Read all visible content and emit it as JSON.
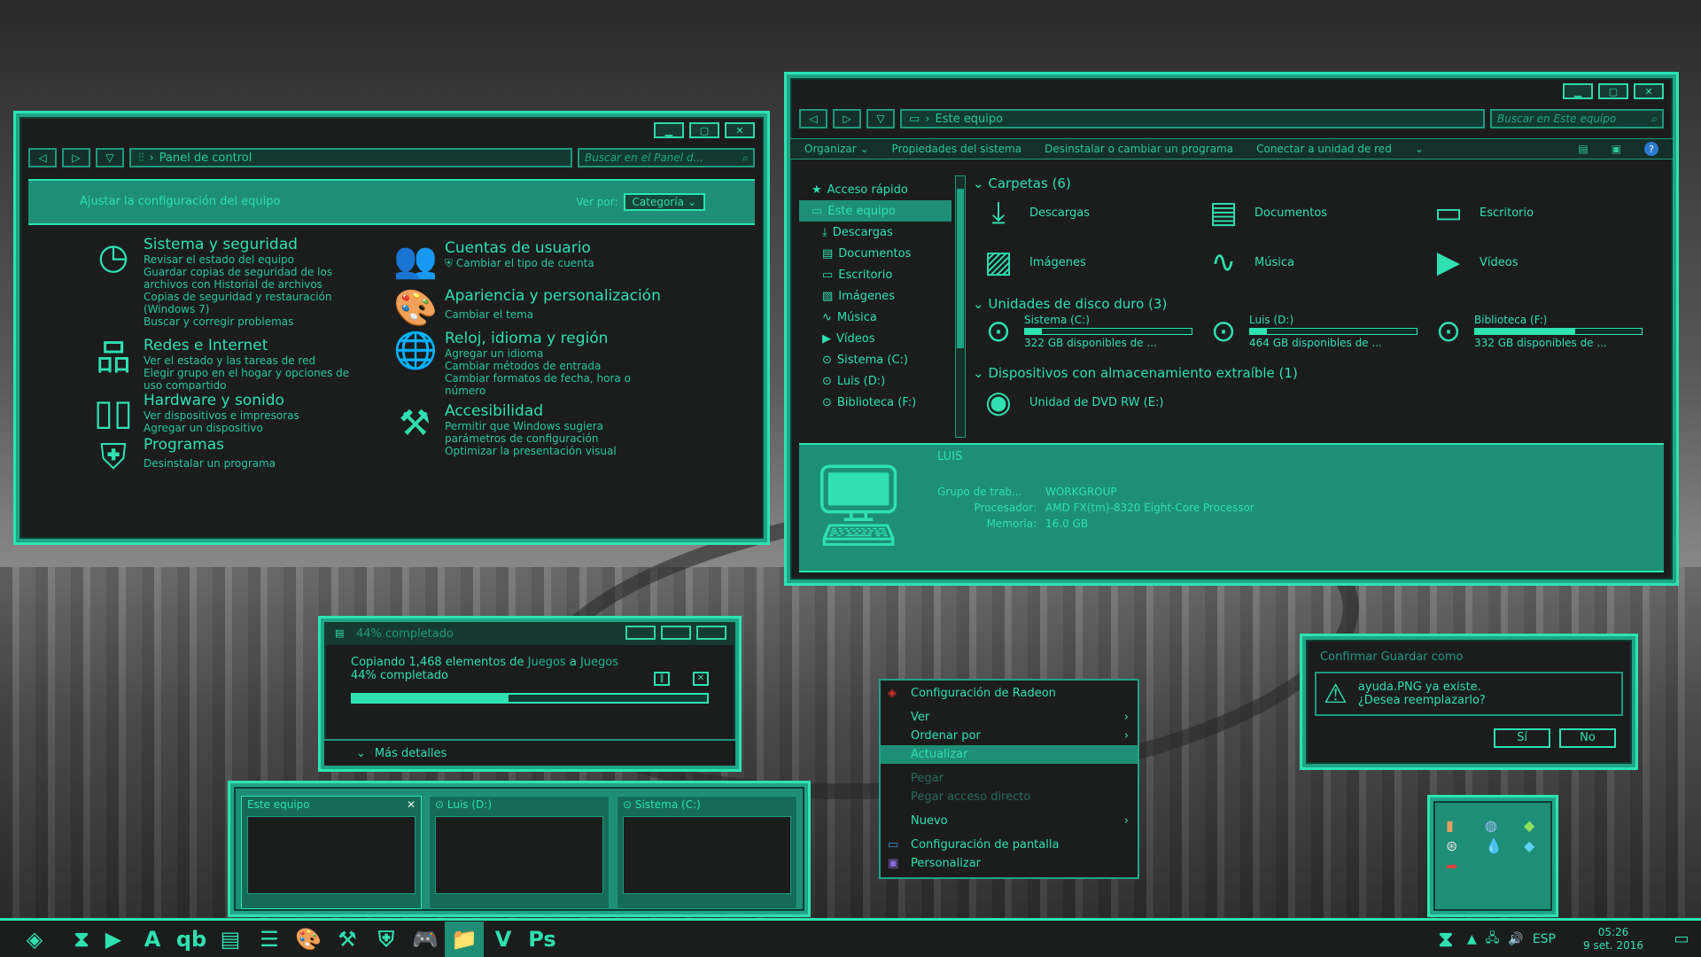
{
  "control_panel": {
    "address": "Panel de control",
    "search_placeholder": "Buscar en el Panel d...",
    "header_title": "Ajustar la configuración del equipo",
    "view_by_label": "Ver por:",
    "view_by_value": "Categoría",
    "categories": [
      {
        "title": "Sistema y seguridad",
        "links": [
          "Revisar el estado del equipo",
          "Guardar copias de seguridad de los",
          "archivos con Historial de archivos",
          "Copias de seguridad y restauración",
          "(Windows 7)",
          "Buscar y corregir problemas"
        ]
      },
      {
        "title": "Redes e Internet",
        "links": [
          "Ver el estado y las tareas de red",
          "Elegir grupo en el hogar y opciones de",
          "uso compartido"
        ]
      },
      {
        "title": "Hardware y sonido",
        "links": [
          "Ver dispositivos e impresoras",
          "Agregar un dispositivo"
        ]
      },
      {
        "title": "Programas",
        "links": [
          "Desinstalar un programa"
        ]
      },
      {
        "title": "Cuentas de usuario",
        "links": [
          "Cambiar el tipo de cuenta"
        ]
      },
      {
        "title": "Apariencia y personalización",
        "links": [
          "Cambiar el tema"
        ]
      },
      {
        "title": "Reloj, idioma y región",
        "links": [
          "Agregar un idioma",
          "Cambiar métodos de entrada",
          "Cambiar formatos de fecha, hora o",
          "número"
        ]
      },
      {
        "title": "Accesibilidad",
        "links": [
          "Permitir que Windows sugiera",
          "parámetros de configuración",
          "Optimizar la presentación visual"
        ]
      }
    ]
  },
  "explorer": {
    "address": "Este equipo",
    "search_placeholder": "Buscar en Este equipo",
    "toolbar": [
      "Organizar",
      "Propiedades del sistema",
      "Desinstalar o cambiar un programa",
      "Conectar a unidad de red"
    ],
    "sidebar": [
      "Acceso rápido",
      "Este equipo",
      "Descargas",
      "Documentos",
      "Escritorio",
      "Imágenes",
      "Música",
      "Vídeos",
      "Sistema (C:)",
      "Luis (D:)",
      "Biblioteca (F:)"
    ],
    "folders_title": "Carpetas (6)",
    "folders": [
      "Descargas",
      "Documentos",
      "Escritorio",
      "Imágenes",
      "Música",
      "Vídeos"
    ],
    "drives_title": "Unidades de disco duro (3)",
    "drives": [
      {
        "name": "Sistema (C:)",
        "free": "322 GB disponibles de ...",
        "used": 0.1
      },
      {
        "name": "Luis (D:)",
        "free": "464 GB disponibles de ...",
        "used": 0.1
      },
      {
        "name": "Biblioteca (F:)",
        "free": "332 GB disponibles de ...",
        "used": 0.6
      }
    ],
    "removable_title": "Dispositivos con almacenamiento extraíble (1)",
    "dvd": "Unidad de DVD RW (E:)",
    "details": {
      "name": "LUIS",
      "workgroup_label": "Grupo de trab...",
      "workgroup": "WORKGROUP",
      "processor_label": "Procesador:",
      "processor": "AMD FX(tm)-8320 Eight-Core Processor",
      "memory_label": "Memoria:",
      "memory": "16.0 GB"
    }
  },
  "copy_dialog": {
    "title": "44% completado",
    "line1_prefix": "Copiando 1,468 elementos de ",
    "from": "Juegos",
    "line1_mid": " a ",
    "to": "Juegos",
    "line2": "44% completado",
    "progress": 0.44,
    "more_details": "Más detalles"
  },
  "context_menu": {
    "items": [
      {
        "label": "Configuración de Radeon",
        "state": "normal"
      },
      {
        "label": "Ver",
        "state": "normal",
        "sub": true
      },
      {
        "label": "Ordenar por",
        "state": "normal",
        "sub": true
      },
      {
        "label": "Actualizar",
        "state": "hi"
      },
      {
        "label": "Pegar",
        "state": "dis"
      },
      {
        "label": "Pegar acceso directo",
        "state": "dis"
      },
      {
        "label": "Nuevo",
        "state": "normal",
        "sub": true
      },
      {
        "label": "Configuración de pantalla",
        "state": "normal"
      },
      {
        "label": "Personalizar",
        "state": "normal"
      }
    ]
  },
  "confirm_dialog": {
    "title": "Confirmar Guardar como",
    "msg1": "ayuda.PNG ya existe.",
    "msg2": "¿Desea reemplazarlo?",
    "yes": "Sí",
    "no": "No"
  },
  "thumbnails": [
    "Este equipo",
    "Luis (D:)",
    "Sistema (C:)"
  ],
  "taskbar": {
    "lang": "ESP",
    "time": "05:26",
    "date": "9 set. 2016",
    "qb": "qb",
    "ps": "Ps"
  }
}
